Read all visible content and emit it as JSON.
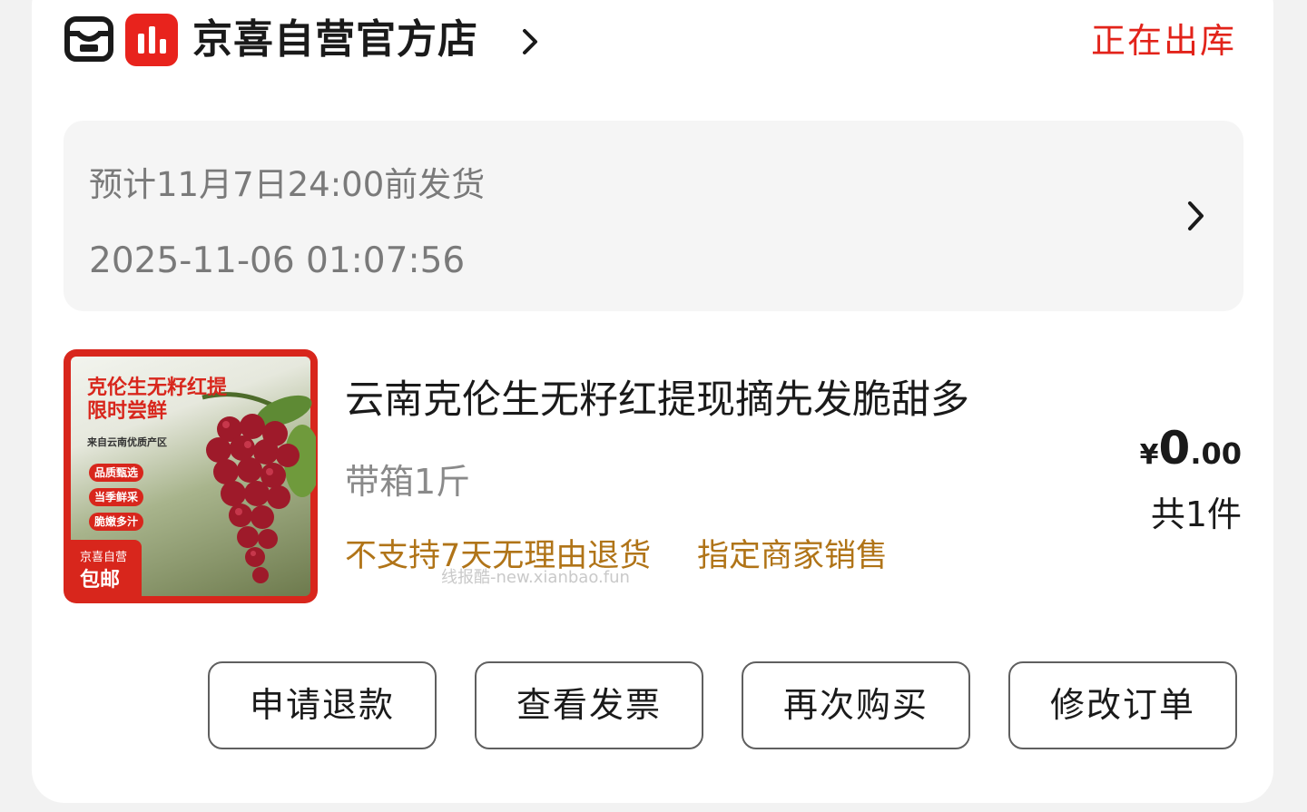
{
  "shop": {
    "name": "京喜自营官方店",
    "status": "正在出库",
    "badge_color": "#e8231d",
    "status_color": "#e2231a"
  },
  "delivery": {
    "estimate": "预计11月7日24:00前发货",
    "timestamp": "2025-11-06 01:07:56"
  },
  "product": {
    "title": "云南克伦生无籽红提现摘先发脆甜多",
    "spec": "带箱1斤",
    "tags": [
      "不支持7天无理由退货",
      "指定商家销售"
    ],
    "price": {
      "currency": "¥",
      "integer": "0",
      "decimal": ".00"
    },
    "quantity": "共1件",
    "image": {
      "title_line1": "克伦生无籽红提",
      "title_line2": "限时尝鲜",
      "subtitle": "来自云南优质产区",
      "tags": [
        "品质甄选",
        "当季鲜采",
        "脆嫩多汁"
      ],
      "corner_line1": "京喜自营",
      "corner_line2": "包邮"
    }
  },
  "watermark": "线报酷-new.xianbao.fun",
  "actions": {
    "refund": "申请退款",
    "invoice": "查看发票",
    "rebuy": "再次购买",
    "modify": "修改订单"
  }
}
